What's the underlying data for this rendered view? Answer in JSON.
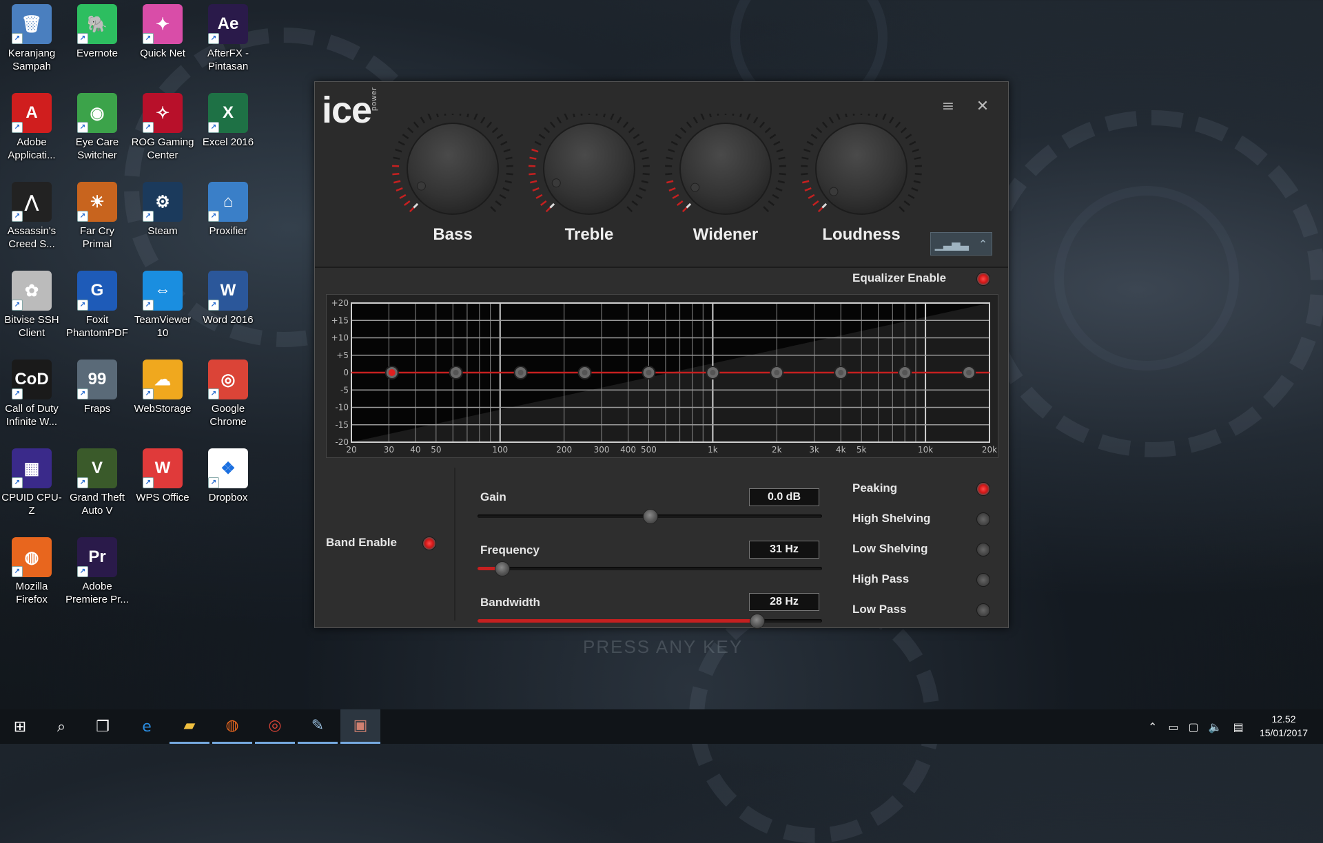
{
  "desktop": {
    "icons": [
      {
        "label": "Keranjang Sampah",
        "glyph": "🗑",
        "color": "#4a7fbf",
        "icon": "recycle-bin-icon"
      },
      {
        "label": "Evernote",
        "glyph": "🐘",
        "color": "#2dbe60",
        "icon": "evernote-icon"
      },
      {
        "label": "Quick Net",
        "glyph": "✦",
        "color": "#d94da8",
        "icon": "quick-net-icon"
      },
      {
        "label": "AfterFX - Pintasan",
        "glyph": "Ae",
        "color": "#2a1a4a",
        "icon": "after-effects-icon"
      },
      {
        "label": "Adobe Applicati...",
        "glyph": "A",
        "color": "#d01e1e",
        "icon": "adobe-app-icon"
      },
      {
        "label": "Eye Care Switcher",
        "glyph": "◉",
        "color": "#3ca34a",
        "icon": "eye-care-icon"
      },
      {
        "label": "ROG Gaming Center",
        "glyph": "✧",
        "color": "#b8102a",
        "icon": "rog-icon"
      },
      {
        "label": "Excel 2016",
        "glyph": "X",
        "color": "#1e7145",
        "icon": "excel-icon"
      },
      {
        "label": "Assassin's Creed S...",
        "glyph": "⋀",
        "color": "#222222",
        "icon": "assassins-creed-icon"
      },
      {
        "label": "Far Cry Primal",
        "glyph": "☀",
        "color": "#c8641e",
        "icon": "far-cry-icon"
      },
      {
        "label": "Steam",
        "glyph": "⚙",
        "color": "#1b3a5c",
        "icon": "steam-icon"
      },
      {
        "label": "Proxifier",
        "glyph": "⌂",
        "color": "#3a7fc8",
        "icon": "proxifier-icon"
      },
      {
        "label": "Bitvise SSH Client",
        "glyph": "✿",
        "color": "#bbbbbb",
        "icon": "bitvise-icon"
      },
      {
        "label": "Foxit PhantomPDF",
        "glyph": "G",
        "color": "#1e5bb8",
        "icon": "foxit-icon"
      },
      {
        "label": "TeamViewer 10",
        "glyph": "⇔",
        "color": "#1a8ee0",
        "icon": "teamviewer-icon"
      },
      {
        "label": "Word 2016",
        "glyph": "W",
        "color": "#2b579a",
        "icon": "word-icon"
      },
      {
        "label": "Call of Duty Infinite W...",
        "glyph": "CoD",
        "color": "#1a1a1a",
        "icon": "call-of-duty-icon"
      },
      {
        "label": "Fraps",
        "glyph": "99",
        "color": "#5a6a78",
        "icon": "fraps-icon"
      },
      {
        "label": "WebStorage",
        "glyph": "☁",
        "color": "#f0a81e",
        "icon": "webstorage-icon"
      },
      {
        "label": "Google Chrome",
        "glyph": "◎",
        "color": "#db4437",
        "icon": "chrome-icon"
      },
      {
        "label": "CPUID CPU-Z",
        "glyph": "▦",
        "color": "#3a2a8a",
        "icon": "cpuz-icon"
      },
      {
        "label": "Grand Theft Auto V",
        "glyph": "V",
        "color": "#3a5a2a",
        "icon": "gta-icon"
      },
      {
        "label": "WPS Office",
        "glyph": "W",
        "color": "#e03a3a",
        "icon": "wps-icon"
      },
      {
        "label": "Dropbox",
        "glyph": "❖",
        "color": "#ffffff",
        "icon": "dropbox-icon"
      },
      {
        "label": "Mozilla Firefox",
        "glyph": "◍",
        "color": "#e8661e",
        "icon": "firefox-icon"
      },
      {
        "label": "Adobe Premiere Pr...",
        "glyph": "Pr",
        "color": "#2a1a4a",
        "icon": "premiere-icon"
      }
    ]
  },
  "app": {
    "logo": "ice",
    "logo_sub": "power",
    "knobs": [
      {
        "label": "Bass",
        "level": 0.06
      },
      {
        "label": "Treble",
        "level": 0.08
      },
      {
        "label": "Widener",
        "level": 0.05
      },
      {
        "label": "Loudness",
        "level": 0.02
      }
    ],
    "equalizer_enable_label": "Equalizer Enable",
    "equalizer_enabled": true,
    "graph": {
      "y_ticks": [
        "+20",
        "+15",
        "+10",
        "+5",
        "0",
        "-5",
        "-10",
        "-15",
        "-20"
      ],
      "x_ticks": [
        "20",
        "30",
        "40",
        "50",
        "100",
        "200",
        "300",
        "400",
        "500",
        "1k",
        "2k",
        "3k",
        "4k",
        "5k",
        "10k",
        "20k"
      ],
      "x_tick_values": [
        20,
        30,
        40,
        50,
        100,
        200,
        300,
        400,
        500,
        1000,
        2000,
        3000,
        4000,
        5000,
        10000,
        20000
      ],
      "band_freqs": [
        31,
        62,
        125,
        250,
        500,
        1000,
        2000,
        4000,
        8000,
        16000
      ],
      "band_gains": [
        0,
        0,
        0,
        0,
        0,
        0,
        0,
        0,
        0,
        0
      ],
      "selected_band": 0,
      "curve_color": "#c62020"
    },
    "band": {
      "enable_label": "Band Enable",
      "enabled": true,
      "gain_label": "Gain",
      "gain_value": "0.0 dB",
      "gain_level": 0.5,
      "frequency_label": "Frequency",
      "frequency_value": "31 Hz",
      "frequency_level": 0.07,
      "bandwidth_label": "Bandwidth",
      "bandwidth_value": "28 Hz",
      "bandwidth_level": 0.81
    },
    "filter_types": [
      {
        "label": "Peaking",
        "selected": true
      },
      {
        "label": "High Shelving",
        "selected": false
      },
      {
        "label": "Low Shelving",
        "selected": false
      },
      {
        "label": "High Pass",
        "selected": false
      },
      {
        "label": "Low Pass",
        "selected": false
      }
    ]
  },
  "wallpaper": {
    "press_text": "PRESS ANY KEY"
  },
  "taskbar": {
    "time": "12.52",
    "date": "15/01/2017"
  }
}
